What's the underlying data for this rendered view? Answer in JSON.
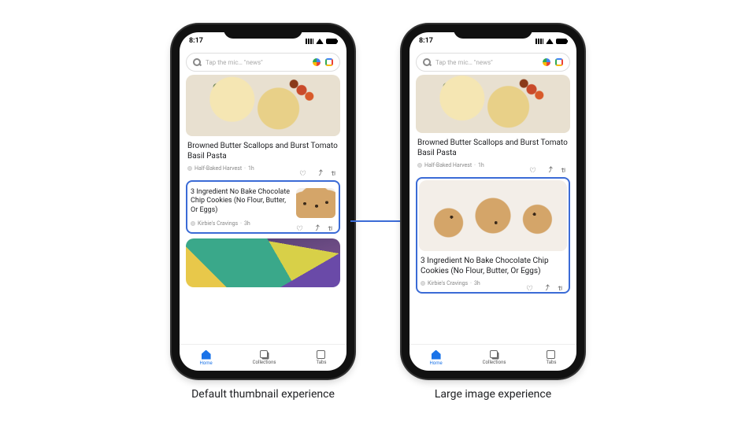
{
  "captions": {
    "left": "Default thumbnail experience",
    "right": "Large image experience"
  },
  "status": {
    "time": "8:17"
  },
  "search": {
    "placeholder": "Tap the mic… \"news\""
  },
  "article1": {
    "title": "Browned Butter Scallops and Burst Tomato Basil Pasta",
    "source": "Half-Baked Harvest",
    "age": "1h"
  },
  "article2": {
    "title": "3 Ingredient No Bake Chocolate Chip Cookies (No Flour, Butter, Or Eggs)",
    "source": "Kirbie's Cravings",
    "age": "3h"
  },
  "nav": {
    "home": "Home",
    "collections": "Collections",
    "tabs": "Tabs"
  }
}
